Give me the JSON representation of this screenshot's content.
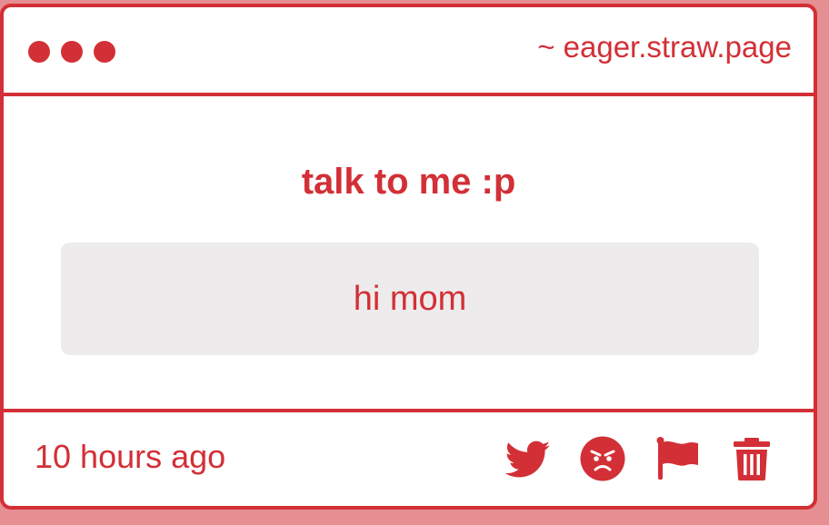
{
  "window": {
    "url": "~ eager.straw.page"
  },
  "message": {
    "prompt": "talk to me :p",
    "reply": "hi mom"
  },
  "footer": {
    "timestamp": "10 hours ago",
    "actions": [
      {
        "icon": "twitter-icon"
      },
      {
        "icon": "angry-face-icon"
      },
      {
        "icon": "flag-icon"
      },
      {
        "icon": "trash-icon"
      }
    ]
  },
  "colors": {
    "accent": "#d32f36",
    "page_background": "#e58f92",
    "card_background": "#ffffff",
    "reply_background": "#edebeb"
  }
}
